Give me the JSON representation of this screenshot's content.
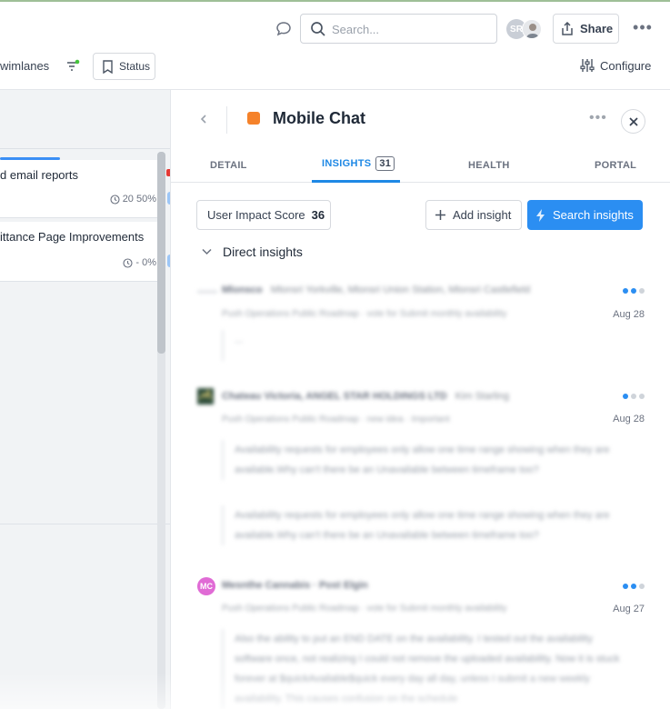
{
  "topbar": {
    "search_placeholder": "Search...",
    "avatar_initials": "SR",
    "share_label": "Share",
    "more_label": "•••"
  },
  "toolbar": {
    "swimlanes_label": "wimlanes",
    "status_label": "Status",
    "configure_label": "Configure"
  },
  "board": {
    "cards": [
      {
        "title": "d email reports",
        "meta": "20  50%"
      },
      {
        "title": "ittance Page Improvements",
        "meta": "-  0%"
      }
    ]
  },
  "panel": {
    "title": "Mobile Chat",
    "color": "#f5822a",
    "more_label": "•••",
    "tabs": [
      {
        "label": "DETAIL"
      },
      {
        "label": "INSIGHTS",
        "count": "31"
      },
      {
        "label": "HEALTH"
      },
      {
        "label": "PORTAL"
      }
    ],
    "active_tab": "INSIGHTS",
    "user_impact_label": "User Impact Score",
    "user_impact_value": "36",
    "add_insight_label": "Add insight",
    "search_insights_label": "Search insights",
    "direct_insights_label": "Direct insights",
    "insights": [
      {
        "author": "Mlonsco",
        "orgs": "Mlonsri Yorkville, Mlonsri Union Station, Mlonsri Castlefield",
        "source": "Push Operations Public Roadmap · vote for Submit monthly availability",
        "date": "Aug 28",
        "dots_on": 2,
        "quotes": [
          "..."
        ]
      },
      {
        "author": "Chateau Victoria, ANGEL STAR HOLDINGS LTD",
        "orgs": "Kim Starling",
        "source": "Push Operations Public Roadmap · new idea · Important",
        "date": "Aug 28",
        "dots_on": 1,
        "quotes": [
          "Availability requests for employees only allow one time range showing when they are available.Why can't there be an Unavailable between timeframe too?",
          "Availability requests for employees only allow one time range showing when they are available.Why can't there be an Unavailable between timeframe too?"
        ]
      },
      {
        "author": "Mesnthe Cannabis · Post Elgin",
        "avatar": "MC",
        "source": "Push Operations Public Roadmap · vote for Submit monthly availability",
        "date": "Aug 27",
        "dots_on": 2,
        "quotes": [
          "Also the ability to put an END DATE on the availability. I tested out the availability software once, not realizing I could not remove the uploaded availability. Now it is stuck forever at $quickAvailable$quick every day all day, unless I submit a new weekly availability. This causes confusion on the schedule"
        ]
      }
    ]
  }
}
